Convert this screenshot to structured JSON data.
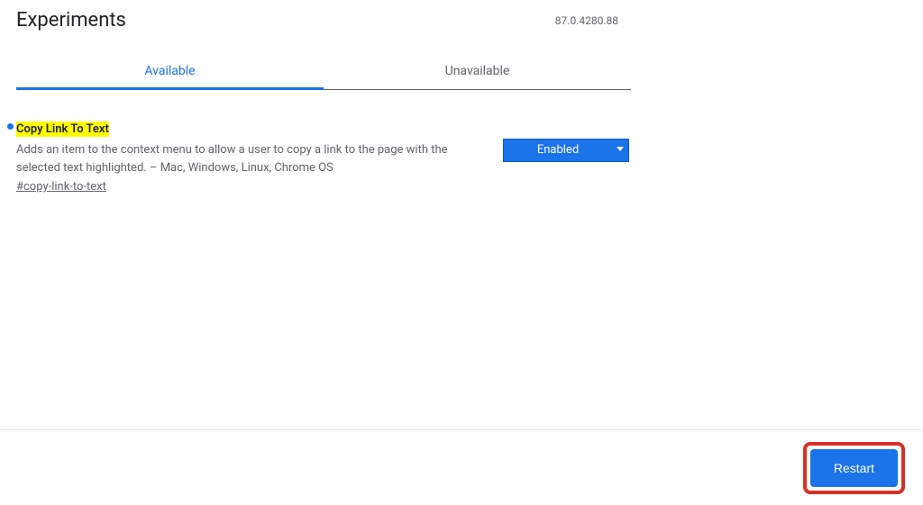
{
  "header": {
    "title": "Experiments",
    "version": "87.0.4280.88"
  },
  "tabs": {
    "available": "Available",
    "unavailable": "Unavailable"
  },
  "experiment": {
    "title": "Copy Link To Text",
    "description": "Adds an item to the context menu to allow a user to copy a link to the page with the selected text highlighted. – Mac, Windows, Linux, Chrome OS",
    "hash": "#copy-link-to-text",
    "selected": "Enabled"
  },
  "footer": {
    "restart": "Restart"
  }
}
